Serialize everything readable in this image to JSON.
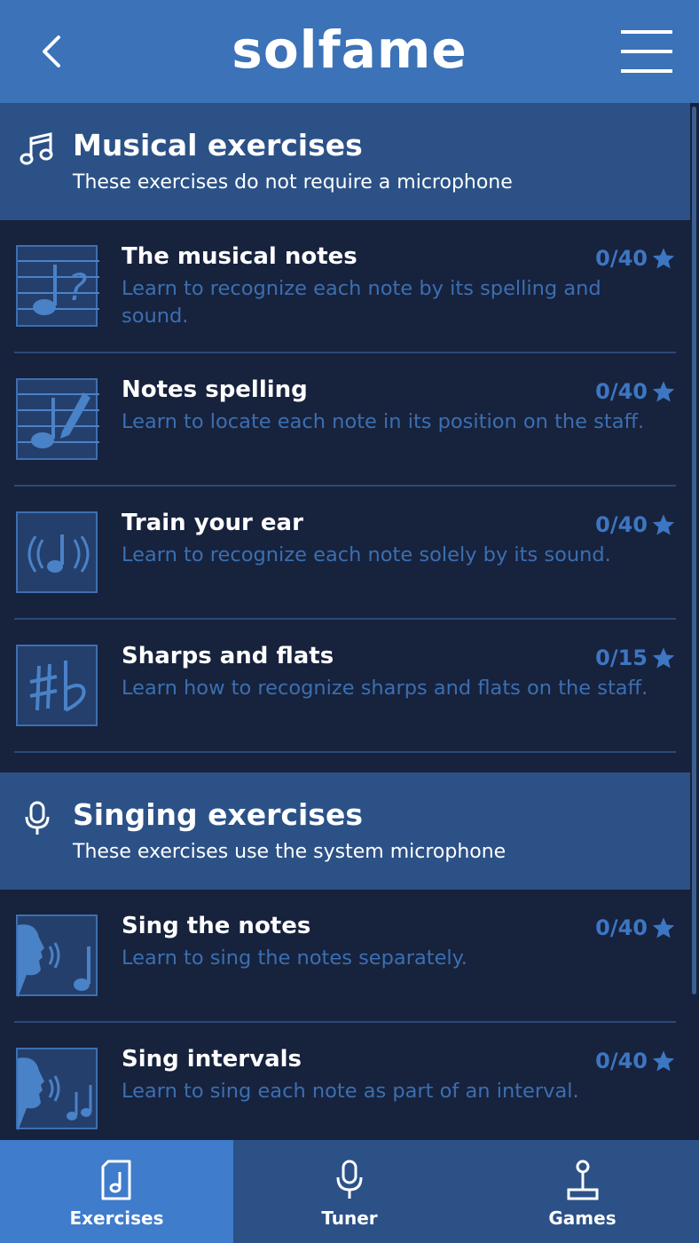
{
  "header": {
    "brand": "solfame",
    "back_icon": "chevron-left-icon",
    "menu_icon": "hamburger-menu-icon"
  },
  "sections": [
    {
      "title": "Musical exercises",
      "subtitle": "These exercises do not require a microphone",
      "icon": "music-note-icon",
      "items": [
        {
          "title": "The musical notes",
          "description": "Learn to recognize each note by its spelling and sound.",
          "score": "0/40",
          "icon": "note-question-icon"
        },
        {
          "title": "Notes spelling",
          "description": "Learn to locate each note in its position on the staff.",
          "score": "0/40",
          "icon": "note-pencil-icon"
        },
        {
          "title": "Train your ear",
          "description": "Learn to recognize each note solely by its sound.",
          "score": "0/40",
          "icon": "note-sound-icon"
        },
        {
          "title": "Sharps and flats",
          "description": "Learn how to recognize sharps and flats on the staff.",
          "score": "0/15",
          "icon": "sharp-flat-icon"
        }
      ]
    },
    {
      "title": "Singing exercises",
      "subtitle": "These exercises use the system microphone",
      "icon": "microphone-icon",
      "items": [
        {
          "title": "Sing the notes",
          "description": "Learn to sing the notes separately.",
          "score": "0/40",
          "icon": "singing-note-icon"
        },
        {
          "title": "Sing intervals",
          "description": "Learn to sing each note as part of an interval.",
          "score": "0/40",
          "icon": "singing-interval-icon"
        }
      ]
    }
  ],
  "tabs": [
    {
      "label": "Exercises",
      "icon": "document-note-icon",
      "active": true
    },
    {
      "label": "Tuner",
      "icon": "microphone-icon",
      "active": false
    },
    {
      "label": "Games",
      "icon": "joystick-icon",
      "active": false
    }
  ],
  "colors": {
    "header": "#3b72b8",
    "section": "#2b5187",
    "background": "#17223d",
    "accent": "#3d76c2",
    "active_tab": "#3f7ccb"
  }
}
